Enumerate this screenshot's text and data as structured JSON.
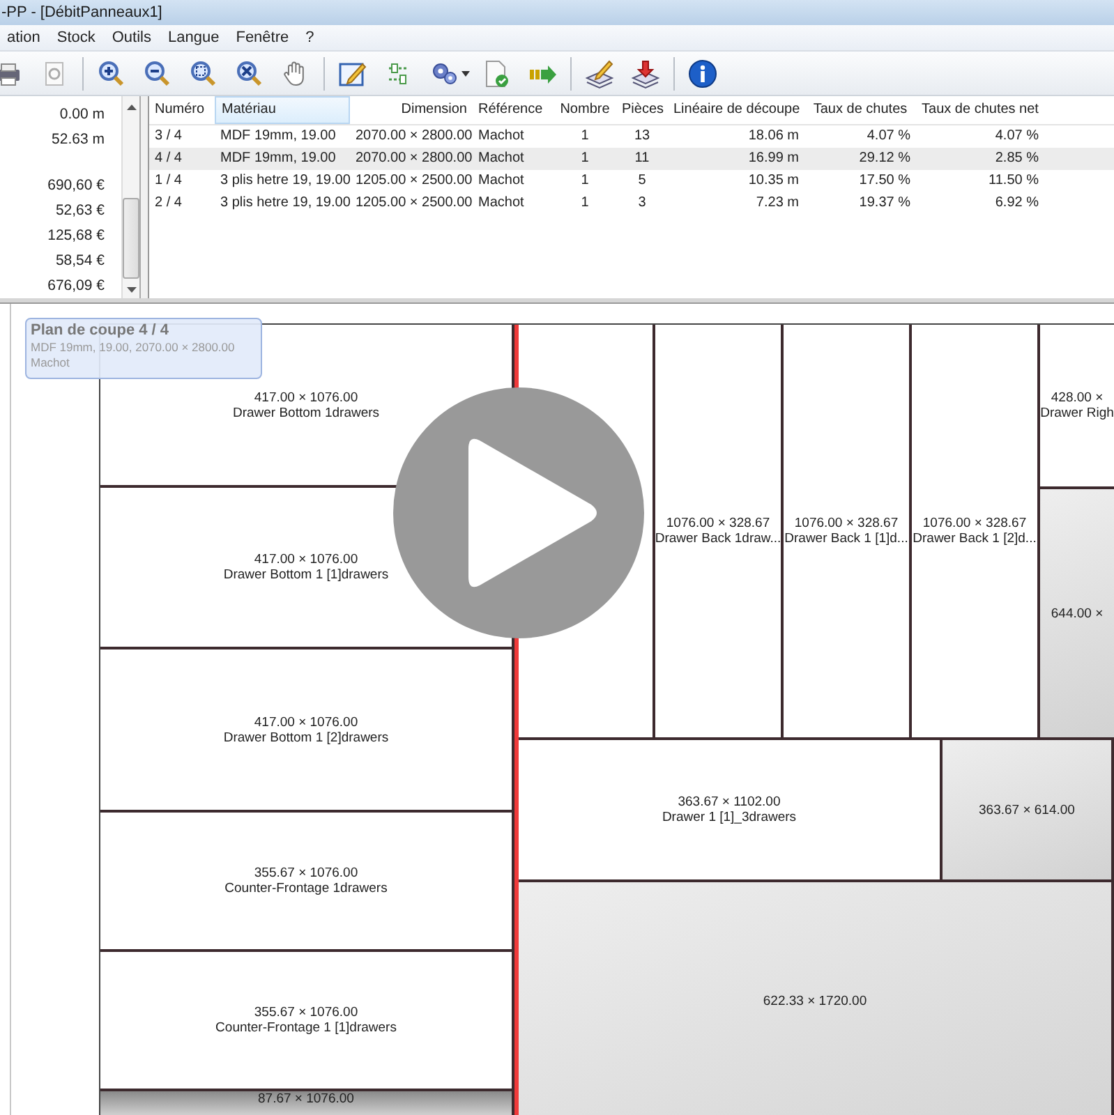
{
  "window": {
    "title": "-PP - [DébitPanneaux1]"
  },
  "menu": [
    "ation",
    "Stock",
    "Outils",
    "Langue",
    "Fenêtre",
    "?"
  ],
  "summary": {
    "lengths": [
      "0.00 m",
      "52.63 m"
    ],
    "costs": [
      "690,60 €",
      "52,63 €",
      "125,68 €",
      "58,54 €",
      "676,09 €"
    ]
  },
  "table": {
    "columns": [
      {
        "label": "Numéro",
        "sorted": false
      },
      {
        "label": "Matériau",
        "sorted": true
      },
      {
        "label": "Dimension",
        "sorted": false
      },
      {
        "label": "Référence",
        "sorted": false
      },
      {
        "label": "Nombre",
        "sorted": false
      },
      {
        "label": "Pièces",
        "sorted": false
      },
      {
        "label": "Linéaire de découpe",
        "sorted": false
      },
      {
        "label": "Taux de chutes",
        "sorted": false
      },
      {
        "label": "Taux de chutes net",
        "sorted": false
      }
    ],
    "rows": [
      {
        "selected": false,
        "cells": [
          "3 / 4",
          "MDF 19mm, 19.00",
          "2070.00 × 2800.00",
          "Machot",
          "1",
          "13",
          "18.06 m",
          "4.07 %",
          "4.07 %"
        ]
      },
      {
        "selected": true,
        "cells": [
          "4 / 4",
          "MDF 19mm, 19.00",
          "2070.00 × 2800.00",
          "Machot",
          "1",
          "11",
          "16.99 m",
          "29.12 %",
          "2.85 %"
        ]
      },
      {
        "selected": false,
        "cells": [
          "1 / 4",
          "3 plis hetre 19, 19.00",
          "1205.00 × 2500.00",
          "Machot",
          "1",
          "5",
          "10.35 m",
          "17.50 %",
          "11.50 %"
        ]
      },
      {
        "selected": false,
        "cells": [
          "2 / 4",
          "3 plis hetre 19, 19.00",
          "1205.00 × 2500.00",
          "Machot",
          "1",
          "3",
          "7.23 m",
          "19.37 %",
          "6.92 %"
        ]
      }
    ]
  },
  "cut_plan": {
    "info": {
      "title": "Plan de coupe 4 / 4",
      "material": "MDF 19mm, 19.00, 2070.00 × 2800.00",
      "supplier": "Machot"
    },
    "left_column": [
      {
        "kind": "piece",
        "size": "417.00 × 1076.00",
        "label": "Drawer Bottom 1drawers"
      },
      {
        "kind": "piece",
        "size": "417.00 × 1076.00",
        "label": "Drawer Bottom 1 [1]drawers"
      },
      {
        "kind": "piece",
        "size": "417.00 × 1076.00",
        "label": "Drawer Bottom 1 [2]drawers"
      },
      {
        "kind": "piece",
        "size": "355.67 × 1076.00",
        "label": "Counter-Frontage 1drawers"
      },
      {
        "kind": "piece",
        "size": "355.67 × 1076.00",
        "label": "Counter-Frontage 1 [1]drawers"
      },
      {
        "kind": "offcut",
        "size": "87.67 × 1076.00"
      }
    ],
    "top_row": [
      {
        "kind": "piece"
      },
      {
        "kind": "piece",
        "size": "1076.00 × 328.67",
        "label": "Drawer Back 1draw..."
      },
      {
        "kind": "piece",
        "size": "1076.00 × 328.67",
        "label": "Drawer Back 1 [1]d..."
      },
      {
        "kind": "piece",
        "size": "1076.00 × 328.67",
        "label": "Drawer Back 1 [2]d..."
      },
      {
        "kind": "stack",
        "children": [
          {
            "kind": "piece",
            "size": "428.00 ×",
            "label": "Drawer Righ"
          },
          {
            "kind": "offcut",
            "size": "644.00 ×"
          }
        ]
      }
    ],
    "middle_row": [
      {
        "kind": "piece",
        "size": "363.67 × 1102.00",
        "label": "Drawer 1 [1]_3drawers"
      },
      {
        "kind": "offcut",
        "size": "363.67 × 614.00"
      }
    ],
    "bottom": {
      "kind": "offcut",
      "size": "622.33 × 1720.00"
    }
  }
}
